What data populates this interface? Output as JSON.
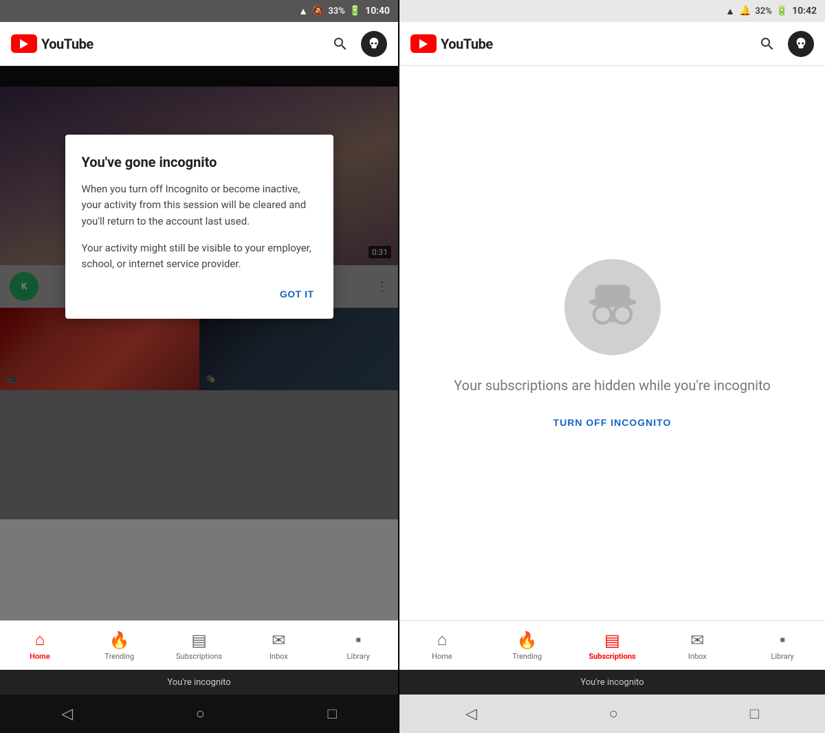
{
  "left": {
    "status": {
      "wifi": "📶",
      "battery": "33%",
      "time": "10:40"
    },
    "header": {
      "app_name": "YouTube",
      "search_label": "search",
      "avatar_label": "incognito avatar"
    },
    "video": {
      "duration": "0:31"
    },
    "modal": {
      "title": "You've gone incognito",
      "body1": "When you turn off Incognito or become inactive, your activity from this session will be cleared and you'll return to the account last used.",
      "body2": "Your activity might still be visible to your employer, school, or internet service provider.",
      "button": "GOT IT"
    },
    "channel": {
      "initials": "K"
    },
    "nav": {
      "items": [
        {
          "label": "Home",
          "active": true
        },
        {
          "label": "Trending",
          "active": false
        },
        {
          "label": "Subscriptions",
          "active": false
        },
        {
          "label": "Inbox",
          "active": false
        },
        {
          "label": "Library",
          "active": false
        }
      ]
    },
    "incognito_bar": "You're incognito"
  },
  "right": {
    "status": {
      "battery": "32%",
      "time": "10:42"
    },
    "header": {
      "app_name": "YouTube",
      "search_label": "search",
      "avatar_label": "incognito avatar"
    },
    "main": {
      "hidden_text": "Your subscriptions are hidden while you're incognito",
      "turn_off_label": "TURN OFF INCOGNITO"
    },
    "nav": {
      "items": [
        {
          "label": "Home",
          "active": false
        },
        {
          "label": "Trending",
          "active": false
        },
        {
          "label": "Subscriptions",
          "active": true
        },
        {
          "label": "Inbox",
          "active": false
        },
        {
          "label": "Library",
          "active": false
        }
      ]
    },
    "incognito_bar": "You're incognito"
  }
}
